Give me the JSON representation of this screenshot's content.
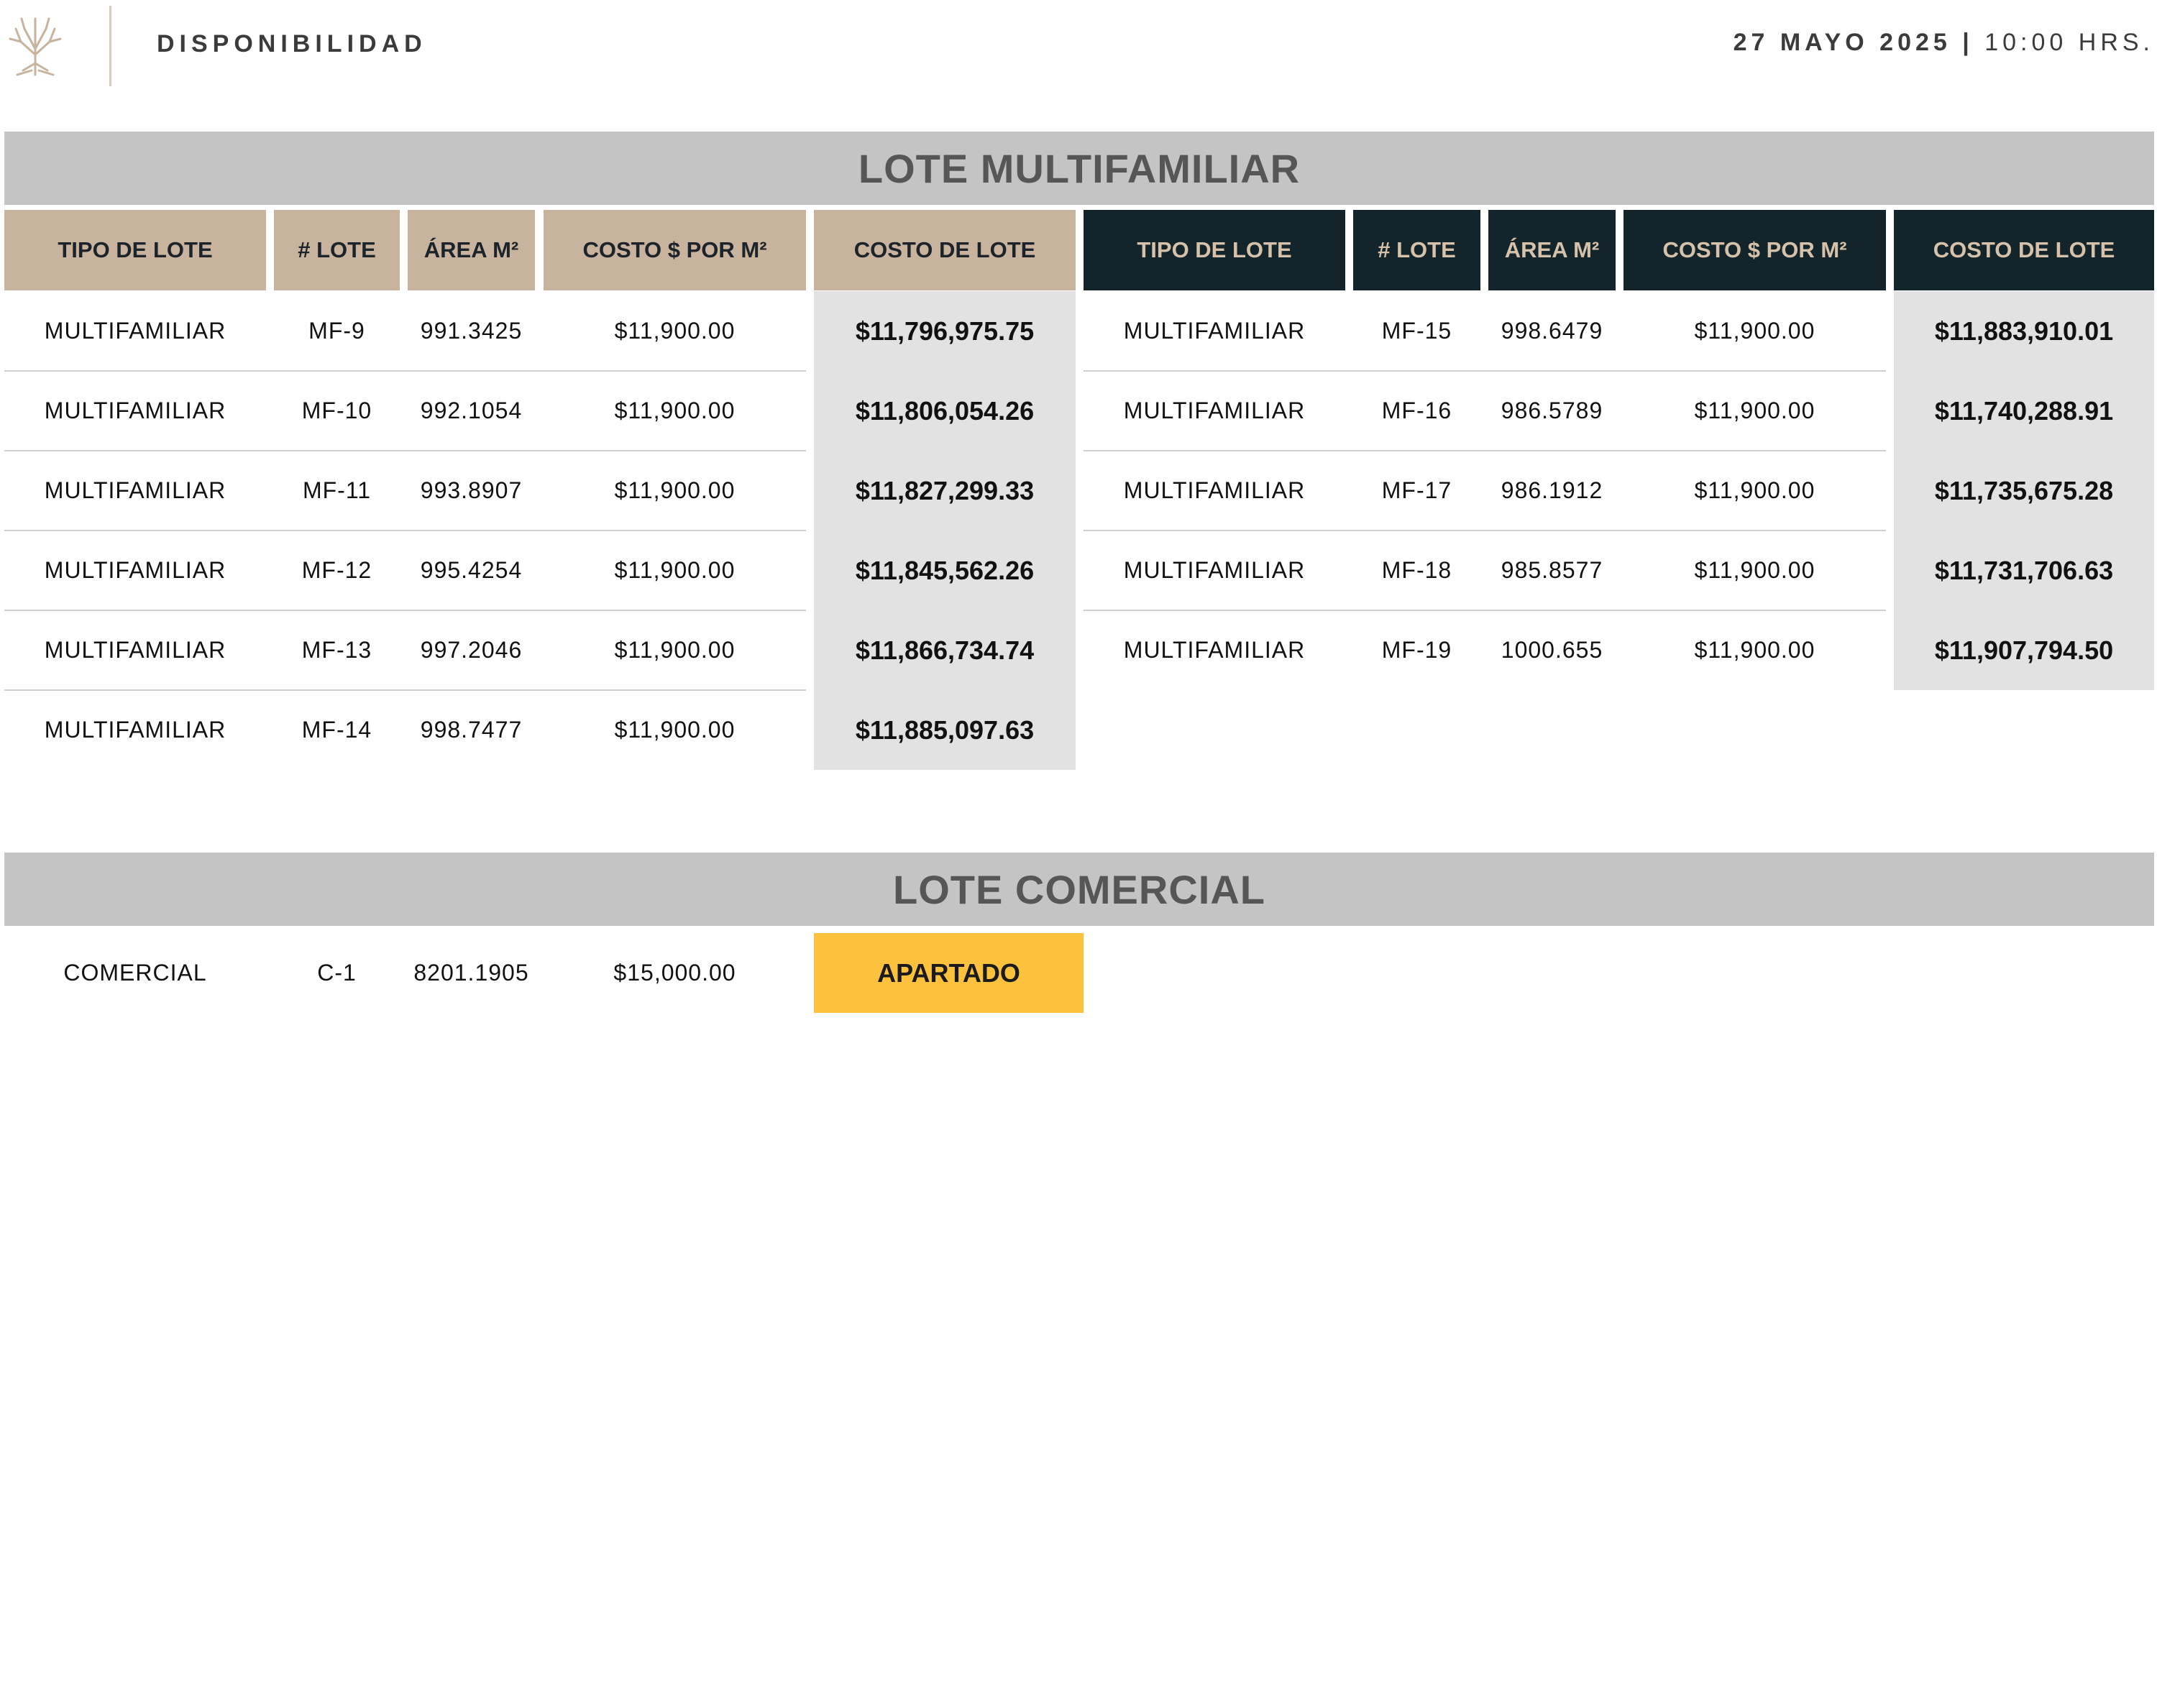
{
  "header": {
    "title": "DISPONIBILIDAD",
    "date": "27 MAYO 2025",
    "separator": "|",
    "time": "10:00 HRS."
  },
  "sections": {
    "multifamiliar_title": "LOTE MULTIFAMILIAR",
    "comercial_title": "LOTE COMERCIAL"
  },
  "columns": [
    "TIPO DE LOTE",
    "# LOTE",
    "ÁREA M²",
    "COSTO $ POR M²",
    "COSTO DE LOTE"
  ],
  "multifamiliar_left": [
    {
      "tipo": "MULTIFAMILIAR",
      "lote": "MF-9",
      "area": "991.3425",
      "costo_m2": "$11,900.00",
      "costo": "$11,796,975.75"
    },
    {
      "tipo": "MULTIFAMILIAR",
      "lote": "MF-10",
      "area": "992.1054",
      "costo_m2": "$11,900.00",
      "costo": "$11,806,054.26"
    },
    {
      "tipo": "MULTIFAMILIAR",
      "lote": "MF-11",
      "area": "993.8907",
      "costo_m2": "$11,900.00",
      "costo": "$11,827,299.33"
    },
    {
      "tipo": "MULTIFAMILIAR",
      "lote": "MF-12",
      "area": "995.4254",
      "costo_m2": "$11,900.00",
      "costo": "$11,845,562.26"
    },
    {
      "tipo": "MULTIFAMILIAR",
      "lote": "MF-13",
      "area": "997.2046",
      "costo_m2": "$11,900.00",
      "costo": "$11,866,734.74"
    },
    {
      "tipo": "MULTIFAMILIAR",
      "lote": "MF-14",
      "area": "998.7477",
      "costo_m2": "$11,900.00",
      "costo": "$11,885,097.63"
    }
  ],
  "multifamiliar_right": [
    {
      "tipo": "MULTIFAMILIAR",
      "lote": "MF-15",
      "area": "998.6479",
      "costo_m2": "$11,900.00",
      "costo": "$11,883,910.01"
    },
    {
      "tipo": "MULTIFAMILIAR",
      "lote": "MF-16",
      "area": "986.5789",
      "costo_m2": "$11,900.00",
      "costo": "$11,740,288.91"
    },
    {
      "tipo": "MULTIFAMILIAR",
      "lote": "MF-17",
      "area": "986.1912",
      "costo_m2": "$11,900.00",
      "costo": "$11,735,675.28"
    },
    {
      "tipo": "MULTIFAMILIAR",
      "lote": "MF-18",
      "area": "985.8577",
      "costo_m2": "$11,900.00",
      "costo": "$11,731,706.63"
    },
    {
      "tipo": "MULTIFAMILIAR",
      "lote": "MF-19",
      "area": "1000.655",
      "costo_m2": "$11,900.00",
      "costo": "$11,907,794.50"
    }
  ],
  "comercial": [
    {
      "tipo": "COMERCIAL",
      "lote": "C-1",
      "area": "8201.1905",
      "costo_m2": "$15,000.00",
      "status": "APARTADO"
    }
  ],
  "colors": {
    "tan_header": "#c7b39e",
    "dark_header": "#14242b",
    "banner": "#c4c4c4",
    "status_reserved": "#fcc13d"
  },
  "icons": {
    "logo": "tree-logo-icon"
  }
}
